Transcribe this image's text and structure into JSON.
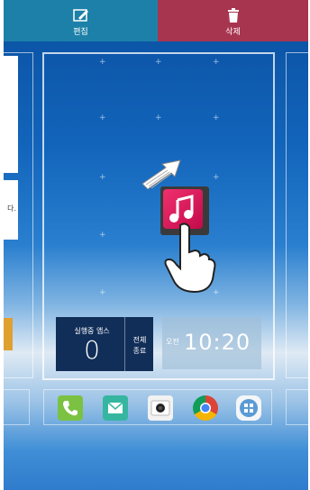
{
  "topbar": {
    "edit_label": "편집",
    "delete_label": "삭제"
  },
  "left_card_text": "다.",
  "running_apps": {
    "label": "실행중 앱스",
    "count": "0",
    "end_label_1": "전체",
    "end_label_2": "종료"
  },
  "clock": {
    "ampm": "오전",
    "time": "10:20"
  },
  "dock": {
    "icons": [
      "phone-icon",
      "message-icon",
      "camera-icon",
      "chrome-icon",
      "apps-icon"
    ]
  },
  "colors": {
    "edit_bar": "#1d80a8",
    "delete_bar": "#a8354f",
    "music": "#e82a68"
  }
}
